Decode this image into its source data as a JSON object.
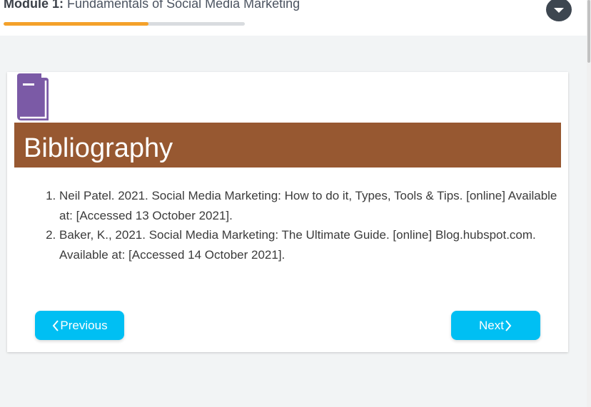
{
  "header": {
    "module_prefix": "Module 1:",
    "module_title": " Fundamentals of Social Media Marketing",
    "progress_fraction": 0.6,
    "dropdown_icon": "chevron-down-icon"
  },
  "card": {
    "icon": "book-icon",
    "heading": "Bibliography",
    "references": [
      "Neil Patel. 2021. Social Media Marketing: How to do it, Types, Tools & Tips. [online] Available at: [Accessed 13 October 2021].",
      "Baker, K., 2021. Social Media Marketing: The Ultimate Guide. [online] Blog.hubspot.com. Available at: [Accessed 14 October 2021]."
    ],
    "prev_label": "Previous",
    "next_label": "Next"
  },
  "colors": {
    "accent_orange": "#f4a12a",
    "heading_band": "#975831",
    "book_icon": "#7b5aa6",
    "nav_button": "#00bff3"
  }
}
